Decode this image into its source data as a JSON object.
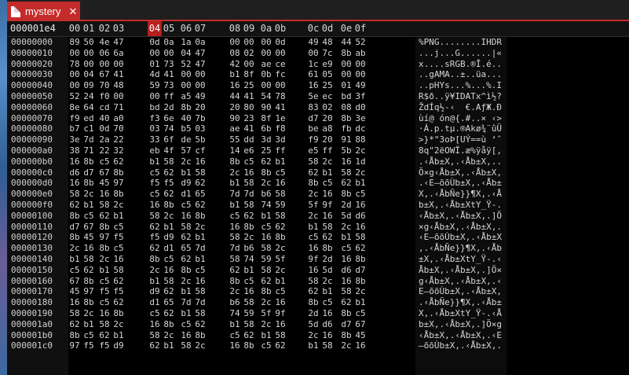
{
  "tab": {
    "title": "mystery",
    "close_glyph": "✕",
    "icon": "file-icon"
  },
  "header": {
    "offset": "000001e4",
    "columns": [
      "00",
      "01",
      "02",
      "03",
      "04",
      "05",
      "06",
      "07",
      "08",
      "09",
      "0a",
      "0b",
      "0c",
      "0d",
      "0e",
      "0f"
    ],
    "active_column": "04"
  },
  "rows": [
    {
      "offset": "00000000",
      "hex": [
        "89",
        "50",
        "4e",
        "47",
        "0d",
        "0a",
        "1a",
        "0a",
        "00",
        "00",
        "00",
        "0d",
        "49",
        "48",
        "44",
        "52"
      ],
      "ascii": "%PNG........IHDR"
    },
    {
      "offset": "00000010",
      "hex": [
        "00",
        "00",
        "06",
        "6a",
        "00",
        "00",
        "04",
        "47",
        "08",
        "02",
        "00",
        "00",
        "00",
        "7c",
        "8b",
        "ab"
      ],
      "ascii": "...j...G......|«"
    },
    {
      "offset": "00000020",
      "hex": [
        "78",
        "00",
        "00",
        "00",
        "01",
        "73",
        "52",
        "47",
        "42",
        "00",
        "ae",
        "ce",
        "1c",
        "e9",
        "00",
        "00"
      ],
      "ascii": "x....sRGB.®Î.é.."
    },
    {
      "offset": "00000030",
      "hex": [
        "00",
        "04",
        "67",
        "41",
        "4d",
        "41",
        "00",
        "00",
        "b1",
        "8f",
        "0b",
        "fc",
        "61",
        "05",
        "00",
        "00"
      ],
      "ascii": "..gAMA..±..üa..."
    },
    {
      "offset": "00000040",
      "hex": [
        "00",
        "09",
        "70",
        "48",
        "59",
        "73",
        "00",
        "00",
        "16",
        "25",
        "00",
        "00",
        "16",
        "25",
        "01",
        "49"
      ],
      "ascii": "..pHYs...%...%.I"
    },
    {
      "offset": "00000050",
      "hex": [
        "52",
        "24",
        "f0",
        "00",
        "00",
        "ff",
        "a5",
        "49",
        "44",
        "41",
        "54",
        "78",
        "5e",
        "ec",
        "bd",
        "3f"
      ],
      "ascii": "R$ð..ÿ¥IDATx^ì½?"
    },
    {
      "offset": "00000060",
      "hex": [
        "8e",
        "64",
        "cd",
        "71",
        "bd",
        "2d",
        "8b",
        "20",
        "20",
        "80",
        "90",
        "41",
        "83",
        "02",
        "08",
        "d0"
      ],
      "ascii": "ŽdÍq½-‹  €.AƒЖ.Ð"
    },
    {
      "offset": "00000070",
      "hex": [
        "f9",
        "ed",
        "40",
        "a0",
        "f3",
        "6e",
        "40",
        "7b",
        "90",
        "23",
        "8f",
        "1e",
        "d7",
        "20",
        "8b",
        "3e"
      ],
      "ascii": "ùí@ ón@{.#..× ‹>"
    },
    {
      "offset": "00000080",
      "hex": [
        "b7",
        "c1",
        "0d",
        "70",
        "03",
        "74",
        "b5",
        "03",
        "ae",
        "41",
        "6b",
        "f8",
        "be",
        "a8",
        "fb",
        "dc"
      ],
      "ascii": "·Á.p.tµ.®Akø¾¨ûÜ"
    },
    {
      "offset": "00000090",
      "hex": [
        "3e",
        "7d",
        "2a",
        "22",
        "33",
        "6f",
        "de",
        "5b",
        "55",
        "dd",
        "3d",
        "3d",
        "f9",
        "20",
        "91",
        "88"
      ],
      "ascii": ">}*\"3oÞ[UÝ==ù ‘ˆ"
    },
    {
      "offset": "000000a0",
      "hex": [
        "38",
        "71",
        "22",
        "32",
        "eb",
        "4f",
        "57",
        "cf",
        "14",
        "e6",
        "25",
        "ff",
        "e5",
        "ff",
        "5b",
        "2c"
      ],
      "ascii": "8q\"2ëOWÏ.æ%ÿåÿ[,"
    },
    {
      "offset": "000000b0",
      "hex": [
        "16",
        "8b",
        "c5",
        "62",
        "b1",
        "58",
        "2c",
        "16",
        "8b",
        "c5",
        "62",
        "b1",
        "58",
        "2c",
        "16",
        "1d"
      ],
      "ascii": ".‹Åb±X,.‹Åb±X,.."
    },
    {
      "offset": "000000c0",
      "hex": [
        "d6",
        "d7",
        "67",
        "8b",
        "c5",
        "62",
        "b1",
        "58",
        "2c",
        "16",
        "8b",
        "c5",
        "62",
        "b1",
        "58",
        "2c"
      ],
      "ascii": "Ö×g‹Åb±X,.‹Åb±X,"
    },
    {
      "offset": "000000d0",
      "hex": [
        "16",
        "8b",
        "45",
        "97",
        "f5",
        "f5",
        "d9",
        "62",
        "b1",
        "58",
        "2c",
        "16",
        "8b",
        "c5",
        "62",
        "b1"
      ],
      "ascii": ".‹E—õõÙb±X,.‹Åb±"
    },
    {
      "offset": "000000e0",
      "hex": [
        "58",
        "2c",
        "16",
        "8b",
        "c5",
        "62",
        "d1",
        "65",
        "7d",
        "7d",
        "b6",
        "58",
        "2c",
        "16",
        "8b",
        "c5"
      ],
      "ascii": "X,.‹ÅbÑe}}¶X,.‹Å"
    },
    {
      "offset": "000000f0",
      "hex": [
        "62",
        "b1",
        "58",
        "2c",
        "16",
        "8b",
        "c5",
        "62",
        "b1",
        "58",
        "74",
        "59",
        "5f",
        "9f",
        "2d",
        "16"
      ],
      "ascii": "b±X,.‹Åb±XtY_Ÿ-."
    },
    {
      "offset": "00000100",
      "hex": [
        "8b",
        "c5",
        "62",
        "b1",
        "58",
        "2c",
        "16",
        "8b",
        "c5",
        "62",
        "b1",
        "58",
        "2c",
        "16",
        "5d",
        "d6"
      ],
      "ascii": "‹Åb±X,.‹Åb±X,.]Ö"
    },
    {
      "offset": "00000110",
      "hex": [
        "d7",
        "67",
        "8b",
        "c5",
        "62",
        "b1",
        "58",
        "2c",
        "16",
        "8b",
        "c5",
        "62",
        "b1",
        "58",
        "2c",
        "16"
      ],
      "ascii": "×g‹Åb±X,.‹Åb±X,."
    },
    {
      "offset": "00000120",
      "hex": [
        "8b",
        "45",
        "97",
        "f5",
        "f5",
        "d9",
        "62",
        "b1",
        "58",
        "2c",
        "16",
        "8b",
        "c5",
        "62",
        "b1",
        "58"
      ],
      "ascii": "‹E—õõÙb±X,.‹Åb±X"
    },
    {
      "offset": "00000130",
      "hex": [
        "2c",
        "16",
        "8b",
        "c5",
        "62",
        "d1",
        "65",
        "7d",
        "7d",
        "b6",
        "58",
        "2c",
        "16",
        "8b",
        "c5",
        "62"
      ],
      "ascii": ",.‹ÅbÑe}}¶X,.‹Åb"
    },
    {
      "offset": "00000140",
      "hex": [
        "b1",
        "58",
        "2c",
        "16",
        "8b",
        "c5",
        "62",
        "b1",
        "58",
        "74",
        "59",
        "5f",
        "9f",
        "2d",
        "16",
        "8b"
      ],
      "ascii": "±X,.‹Åb±XtY_Ÿ-.‹"
    },
    {
      "offset": "00000150",
      "hex": [
        "c5",
        "62",
        "b1",
        "58",
        "2c",
        "16",
        "8b",
        "c5",
        "62",
        "b1",
        "58",
        "2c",
        "16",
        "5d",
        "d6",
        "d7"
      ],
      "ascii": "Åb±X,.‹Åb±X,.]Ö×"
    },
    {
      "offset": "00000160",
      "hex": [
        "67",
        "8b",
        "c5",
        "62",
        "b1",
        "58",
        "2c",
        "16",
        "8b",
        "c5",
        "62",
        "b1",
        "58",
        "2c",
        "16",
        "8b"
      ],
      "ascii": "g‹Åb±X,.‹Åb±X,.‹"
    },
    {
      "offset": "00000170",
      "hex": [
        "45",
        "97",
        "f5",
        "f5",
        "d9",
        "62",
        "b1",
        "58",
        "2c",
        "16",
        "8b",
        "c5",
        "62",
        "b1",
        "58",
        "2c"
      ],
      "ascii": "E—õõÙb±X,.‹Åb±X,"
    },
    {
      "offset": "00000180",
      "hex": [
        "16",
        "8b",
        "c5",
        "62",
        "d1",
        "65",
        "7d",
        "7d",
        "b6",
        "58",
        "2c",
        "16",
        "8b",
        "c5",
        "62",
        "b1"
      ],
      "ascii": ".‹ÅbÑe}}¶X,.‹Åb±"
    },
    {
      "offset": "00000190",
      "hex": [
        "58",
        "2c",
        "16",
        "8b",
        "c5",
        "62",
        "b1",
        "58",
        "74",
        "59",
        "5f",
        "9f",
        "2d",
        "16",
        "8b",
        "c5"
      ],
      "ascii": "X,.‹Åb±XtY_Ÿ-.‹Å"
    },
    {
      "offset": "000001a0",
      "hex": [
        "62",
        "b1",
        "58",
        "2c",
        "16",
        "8b",
        "c5",
        "62",
        "b1",
        "58",
        "2c",
        "16",
        "5d",
        "d6",
        "d7",
        "67"
      ],
      "ascii": "b±X,.‹Åb±X,.]Ö×g"
    },
    {
      "offset": "000001b0",
      "hex": [
        "8b",
        "c5",
        "62",
        "b1",
        "58",
        "2c",
        "16",
        "8b",
        "c5",
        "62",
        "b1",
        "58",
        "2c",
        "16",
        "8b",
        "45"
      ],
      "ascii": "‹Åb±X,.‹Åb±X,.‹E"
    },
    {
      "offset": "000001c0",
      "hex": [
        "97",
        "f5",
        "f5",
        "d9",
        "62",
        "b1",
        "58",
        "2c",
        "16",
        "8b",
        "c5",
        "62",
        "b1",
        "58",
        "2c",
        "16"
      ],
      "ascii": "—õõÙb±X,.‹Åb±X,."
    }
  ]
}
